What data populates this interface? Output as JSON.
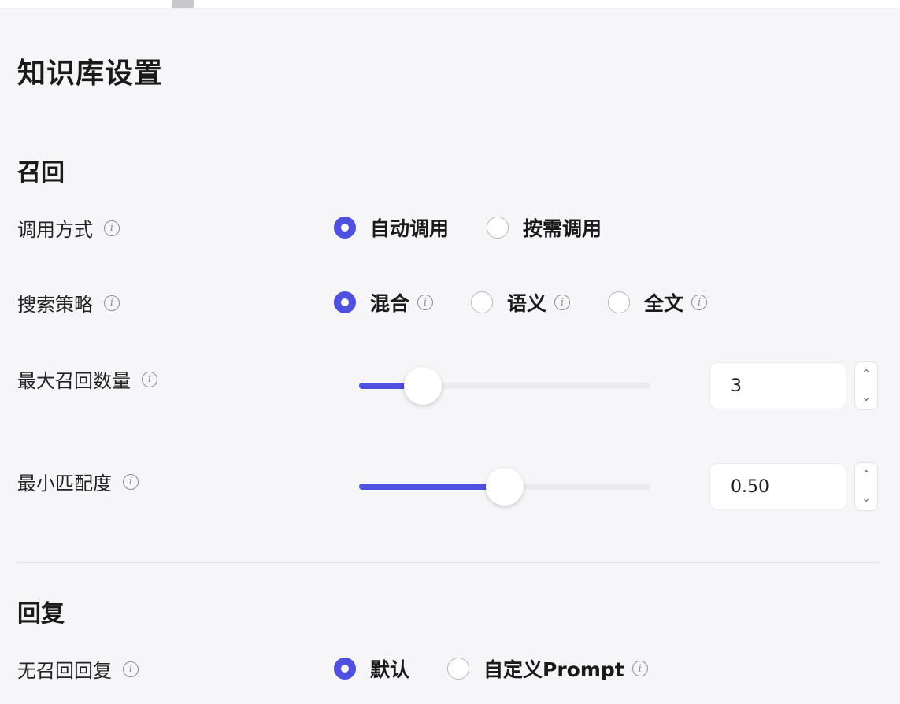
{
  "page": {
    "title": "知识库设置"
  },
  "recall": {
    "section_title": "召回",
    "call_mode": {
      "label": "调用方式",
      "options": [
        {
          "label": "自动调用",
          "checked": true
        },
        {
          "label": "按需调用",
          "checked": false
        }
      ]
    },
    "search_strategy": {
      "label": "搜索策略",
      "options": [
        {
          "label": "混合",
          "checked": true
        },
        {
          "label": "语义",
          "checked": false
        },
        {
          "label": "全文",
          "checked": false
        }
      ]
    },
    "max_recall": {
      "label": "最大召回数量",
      "value": "3",
      "slider_fraction": 0.22
    },
    "min_match": {
      "label": "最小匹配度",
      "value": "0.50",
      "slider_fraction": 0.5
    }
  },
  "reply": {
    "section_title": "回复",
    "no_recall_reply": {
      "label": "无召回回复",
      "options": [
        {
          "label": "默认",
          "checked": true
        },
        {
          "label": "自定义Prompt",
          "checked": false
        }
      ]
    }
  },
  "icons": {
    "info": "info-icon",
    "up": "chevron-up-icon",
    "down": "chevron-down-icon"
  },
  "colors": {
    "accent": "#4f4fe0",
    "background": "#f6f6f8"
  }
}
